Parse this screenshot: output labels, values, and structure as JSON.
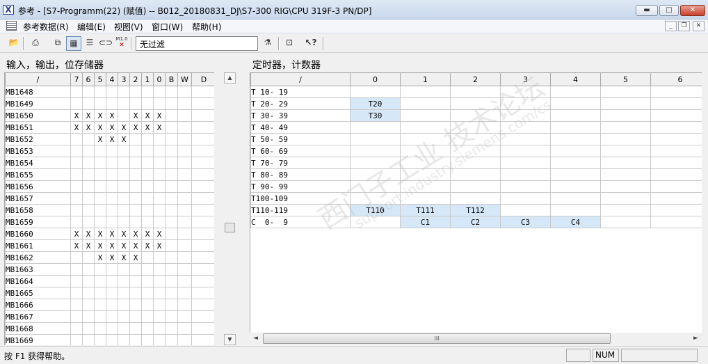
{
  "window": {
    "title": "参考 - [S7-Programm(22) (赋值) -- B012_20180831_DJ\\S7-300 RIG\\CPU 319F-3 PN/DP]",
    "min_glyph": "▬",
    "max_glyph": "□",
    "close_glyph": "✕"
  },
  "menu": {
    "ref": "参考数据(R)",
    "edit": "编辑(E)",
    "view": "视图(V)",
    "window": "窗口(W)",
    "help": "帮助(H)",
    "mdi_min": "_",
    "mdi_restore": "❐",
    "mdi_close": "✕"
  },
  "toolbar": {
    "filter_value": "无过滤",
    "m10_label": "M1.0"
  },
  "left_panel": {
    "title": "输入，输出，位存储器",
    "corner_label": "/",
    "bit_headers": [
      "7",
      "6",
      "5",
      "4",
      "3",
      "2",
      "1",
      "0",
      "B",
      "W",
      "D"
    ],
    "rows": [
      {
        "name": "MB1648",
        "bits": [
          "",
          "",
          "",
          "",
          "",
          "",
          "",
          "",
          "",
          "",
          ""
        ]
      },
      {
        "name": "MB1649",
        "bits": [
          "",
          "",
          "",
          "",
          "",
          "",
          "",
          "",
          "",
          "",
          ""
        ]
      },
      {
        "name": "MB1650",
        "bits": [
          "X",
          "X",
          "X",
          "X",
          "",
          "X",
          "X",
          "X",
          "",
          "",
          ""
        ]
      },
      {
        "name": "MB1651",
        "bits": [
          "X",
          "X",
          "X",
          "X",
          "X",
          "X",
          "X",
          "X",
          "",
          "",
          ""
        ]
      },
      {
        "name": "MB1652",
        "bits": [
          "",
          "",
          "X",
          "X",
          "X",
          "",
          "",
          "",
          "",
          "",
          ""
        ]
      },
      {
        "name": "MB1653",
        "bits": [
          "",
          "",
          "",
          "",
          "",
          "",
          "",
          "",
          "",
          "",
          ""
        ]
      },
      {
        "name": "MB1654",
        "bits": [
          "",
          "",
          "",
          "",
          "",
          "",
          "",
          "",
          "",
          "",
          ""
        ]
      },
      {
        "name": "MB1655",
        "bits": [
          "",
          "",
          "",
          "",
          "",
          "",
          "",
          "",
          "",
          "",
          ""
        ]
      },
      {
        "name": "MB1656",
        "bits": [
          "",
          "",
          "",
          "",
          "",
          "",
          "",
          "",
          "",
          "",
          ""
        ]
      },
      {
        "name": "MB1657",
        "bits": [
          "",
          "",
          "",
          "",
          "",
          "",
          "",
          "",
          "",
          "",
          ""
        ]
      },
      {
        "name": "MB1658",
        "bits": [
          "",
          "",
          "",
          "",
          "",
          "",
          "",
          "",
          "",
          "",
          ""
        ]
      },
      {
        "name": "MB1659",
        "bits": [
          "",
          "",
          "",
          "",
          "",
          "",
          "",
          "",
          "",
          "",
          ""
        ]
      },
      {
        "name": "MB1660",
        "bits": [
          "X",
          "X",
          "X",
          "X",
          "X",
          "X",
          "X",
          "X",
          "",
          "",
          ""
        ]
      },
      {
        "name": "MB1661",
        "bits": [
          "X",
          "X",
          "X",
          "X",
          "X",
          "X",
          "X",
          "X",
          "",
          "",
          ""
        ]
      },
      {
        "name": "MB1662",
        "bits": [
          "",
          "",
          "X",
          "X",
          "X",
          "X",
          "",
          "",
          "",
          "",
          ""
        ]
      },
      {
        "name": "MB1663",
        "bits": [
          "",
          "",
          "",
          "",
          "",
          "",
          "",
          "",
          "",
          "",
          ""
        ]
      },
      {
        "name": "MB1664",
        "bits": [
          "",
          "",
          "",
          "",
          "",
          "",
          "",
          "",
          "",
          "",
          ""
        ]
      },
      {
        "name": "MB1665",
        "bits": [
          "",
          "",
          "",
          "",
          "",
          "",
          "",
          "",
          "",
          "",
          ""
        ]
      },
      {
        "name": "MB1666",
        "bits": [
          "",
          "",
          "",
          "",
          "",
          "",
          "",
          "",
          "",
          "",
          ""
        ]
      },
      {
        "name": "MB1667",
        "bits": [
          "",
          "",
          "",
          "",
          "",
          "",
          "",
          "",
          "",
          "",
          ""
        ]
      },
      {
        "name": "MB1668",
        "bits": [
          "",
          "",
          "",
          "",
          "",
          "",
          "",
          "",
          "",
          "",
          ""
        ]
      },
      {
        "name": "MB1669",
        "bits": [
          "",
          "",
          "",
          "",
          "",
          "",
          "",
          "",
          "",
          "",
          ""
        ]
      }
    ]
  },
  "right_panel": {
    "title": "定时器，计数器",
    "corner_label": "/",
    "col_headers": [
      "0",
      "1",
      "2",
      "3",
      "4",
      "5",
      "6"
    ],
    "rows": [
      {
        "name": "T 10- 19",
        "cells": [
          "",
          "",
          "",
          "",
          "",
          "",
          ""
        ]
      },
      {
        "name": "T 20- 29",
        "cells": [
          "T20",
          "",
          "",
          "",
          "",
          "",
          ""
        ]
      },
      {
        "name": "T 30- 39",
        "cells": [
          "T30",
          "",
          "",
          "",
          "",
          "",
          ""
        ]
      },
      {
        "name": "T 40- 49",
        "cells": [
          "",
          "",
          "",
          "",
          "",
          "",
          ""
        ]
      },
      {
        "name": "T 50- 59",
        "cells": [
          "",
          "",
          "",
          "",
          "",
          "",
          ""
        ]
      },
      {
        "name": "T 60- 69",
        "cells": [
          "",
          "",
          "",
          "",
          "",
          "",
          ""
        ]
      },
      {
        "name": "T 70- 79",
        "cells": [
          "",
          "",
          "",
          "",
          "",
          "",
          ""
        ]
      },
      {
        "name": "T 80- 89",
        "cells": [
          "",
          "",
          "",
          "",
          "",
          "",
          ""
        ]
      },
      {
        "name": "T 90- 99",
        "cells": [
          "",
          "",
          "",
          "",
          "",
          "",
          ""
        ]
      },
      {
        "name": "T100-109",
        "cells": [
          "",
          "",
          "",
          "",
          "",
          "",
          ""
        ]
      },
      {
        "name": "T110-119",
        "cells": [
          "T110",
          "T111",
          "T112",
          "",
          "",
          "",
          ""
        ]
      },
      {
        "name": "C  0-  9",
        "cells": [
          "",
          "C1",
          "C2",
          "C3",
          "C4",
          "",
          ""
        ]
      }
    ],
    "hscroll_thumb_glyph": "III"
  },
  "watermark": {
    "main": "西门子工业  技术论坛",
    "url": "support.industry.siemens.com/cs"
  },
  "status": {
    "help_text": "按 F1 获得帮助。",
    "num": "NUM"
  }
}
